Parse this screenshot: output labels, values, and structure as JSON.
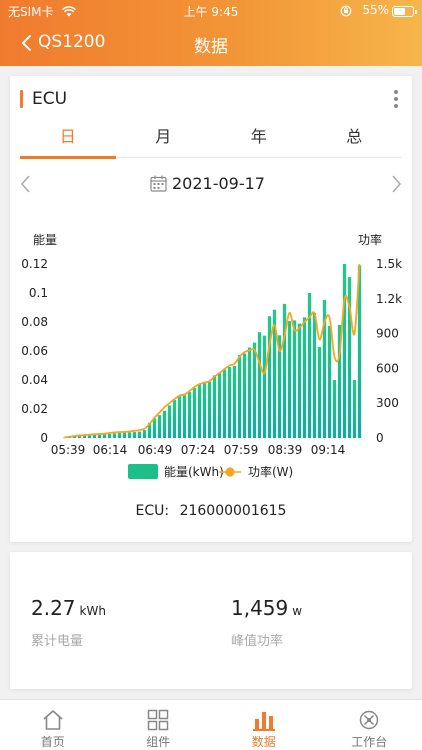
{
  "status_bar": {
    "carrier": "无SIM卡",
    "time": "上午 9:45",
    "battery": "55%"
  },
  "nav": {
    "back_label": "QS1200",
    "title": "数据"
  },
  "ecu_card": {
    "title": "ECU",
    "tabs": [
      "日",
      "月",
      "年",
      "总"
    ],
    "active_tab": "日",
    "date": "2021-09-17",
    "ecu_prefix": "ECU:",
    "ecu_id": "216000001615"
  },
  "chart_data": {
    "type": "bar",
    "left_axis_label": "能量",
    "right_axis_label": "功率",
    "y_left_ticks": [
      "0.12",
      "0.1",
      "0.08",
      "0.06",
      "0.04",
      "0.02",
      "0"
    ],
    "y_right_ticks": [
      "1.5k",
      "1.2k",
      "900",
      "600",
      "300",
      "0"
    ],
    "x_ticks": [
      "05:39",
      "06:14",
      "06:49",
      "07:24",
      "07:59",
      "08:39",
      "09:14"
    ],
    "ylim_left": [
      0,
      0.12
    ],
    "ylim_right": [
      0,
      1500
    ],
    "legend": [
      "能量(kWh)",
      "功率(W)"
    ],
    "colors": {
      "energy": "#1cbf8a",
      "power": "#f5a623"
    },
    "series": [
      {
        "name": "能量(kWh)",
        "type": "bar",
        "values": [
          0.0003,
          0.0008,
          0.0013,
          0.0017,
          0.0019,
          0.0021,
          0.0023,
          0.0025,
          0.0027,
          0.0029,
          0.0032,
          0.0035,
          0.0037,
          0.0039,
          0.0041,
          0.0044,
          0.0055,
          0.0105,
          0.0135,
          0.0158,
          0.0188,
          0.0225,
          0.0262,
          0.0292,
          0.0295,
          0.0318,
          0.0345,
          0.0372,
          0.0378,
          0.0388,
          0.0432,
          0.0452,
          0.0473,
          0.049,
          0.0497,
          0.0572,
          0.0583,
          0.0624,
          0.0658,
          0.073,
          0.0706,
          0.084,
          0.0885,
          0.0708,
          0.0925,
          0.0806,
          0.0811,
          0.0789,
          0.0832,
          0.1,
          0.0863,
          0.0627,
          0.0953,
          0.0773,
          0.04,
          0.078,
          0.12,
          0.111,
          0.04,
          0.119
        ]
      },
      {
        "name": "功率(W)",
        "type": "line",
        "values": [
          5,
          11,
          17,
          22,
          26,
          29,
          32,
          35,
          38,
          43,
          48,
          51,
          53,
          56,
          62,
          68,
          80,
          120,
          175,
          220,
          265,
          300,
          335,
          365,
          375,
          405,
          440,
          465,
          478,
          490,
          530,
          560,
          595,
          625,
          640,
          700,
          740,
          755,
          760,
          650,
          560,
          805,
          975,
          750,
          880,
          1080,
          930,
          950,
          1000,
          1040,
          1075,
          850,
          1000,
          1040,
          700,
          720,
          1200,
          1130,
          900,
          1500
        ]
      }
    ]
  },
  "summary": {
    "energy": {
      "value": "2.27",
      "unit": "kWh",
      "label": "累计电量"
    },
    "peak": {
      "value": "1,459",
      "unit": "w",
      "label": "峰值功率"
    }
  },
  "tabbar": {
    "items": [
      "首页",
      "组件",
      "数据",
      "工作台"
    ],
    "active": "数据"
  }
}
